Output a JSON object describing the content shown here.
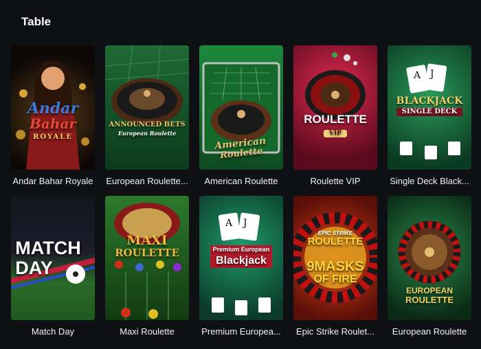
{
  "section": {
    "title": "Table"
  },
  "games": [
    {
      "title": "Andar Bahar Royale",
      "art": [
        "Andar",
        "Bahar",
        "ROYALE"
      ],
      "bg1": "#3a2410",
      "bg2": "#0d0806",
      "accent": "#d9a63a"
    },
    {
      "title": "European Roulette...",
      "art": [
        "ANNOUNCED BETS",
        "European Roulette"
      ],
      "bg1": "#1f6a35",
      "bg2": "#0c3a1c",
      "accent": "#e8c46a"
    },
    {
      "title": "American Roulette",
      "art": [
        "American",
        "Roulette"
      ],
      "bg1": "#1c8a3c",
      "bg2": "#0e4a20",
      "accent": "#e6c37a"
    },
    {
      "title": "Roulette VIP",
      "art": [
        "ROULETTE",
        "VIP"
      ],
      "bg1": "#c4163c",
      "bg2": "#5a0a1c",
      "accent": "#ffffff"
    },
    {
      "title": "Single Deck Black...",
      "art": [
        "BLACKJACK",
        "SINGLE DECK"
      ],
      "bg1": "#1f7a4a",
      "bg2": "#0b3a22",
      "accent": "#f3d162"
    },
    {
      "title": "Match Day",
      "art": [
        "MATCH",
        "DAY"
      ],
      "bg1": "#1c1c2a",
      "bg2": "#2a6a28",
      "accent": "#ffffff"
    },
    {
      "title": "Maxi Roulette",
      "art": [
        "MAXI",
        "ROULETTE"
      ],
      "bg1": "#2c7a2c",
      "bg2": "#123a12",
      "accent": "#f0b93a"
    },
    {
      "title": "Premium Europea...",
      "art": [
        "Premium European",
        "Blackjack"
      ],
      "bg1": "#1a7a5a",
      "bg2": "#0b3a2a",
      "accent": "#ffffff"
    },
    {
      "title": "Epic Strike Roulet...",
      "art": [
        "EPIC STRIKE",
        "ROULETTE",
        "9MASKS",
        "OF FIRE"
      ],
      "bg1": "#d0361a",
      "bg2": "#5a0e08",
      "accent": "#ffd23a"
    },
    {
      "title": "European Roulette",
      "art": [
        "EUROPEAN",
        "ROULETTE"
      ],
      "bg1": "#1b6a3a",
      "bg2": "#0a2a16",
      "accent": "#f3d162"
    }
  ]
}
